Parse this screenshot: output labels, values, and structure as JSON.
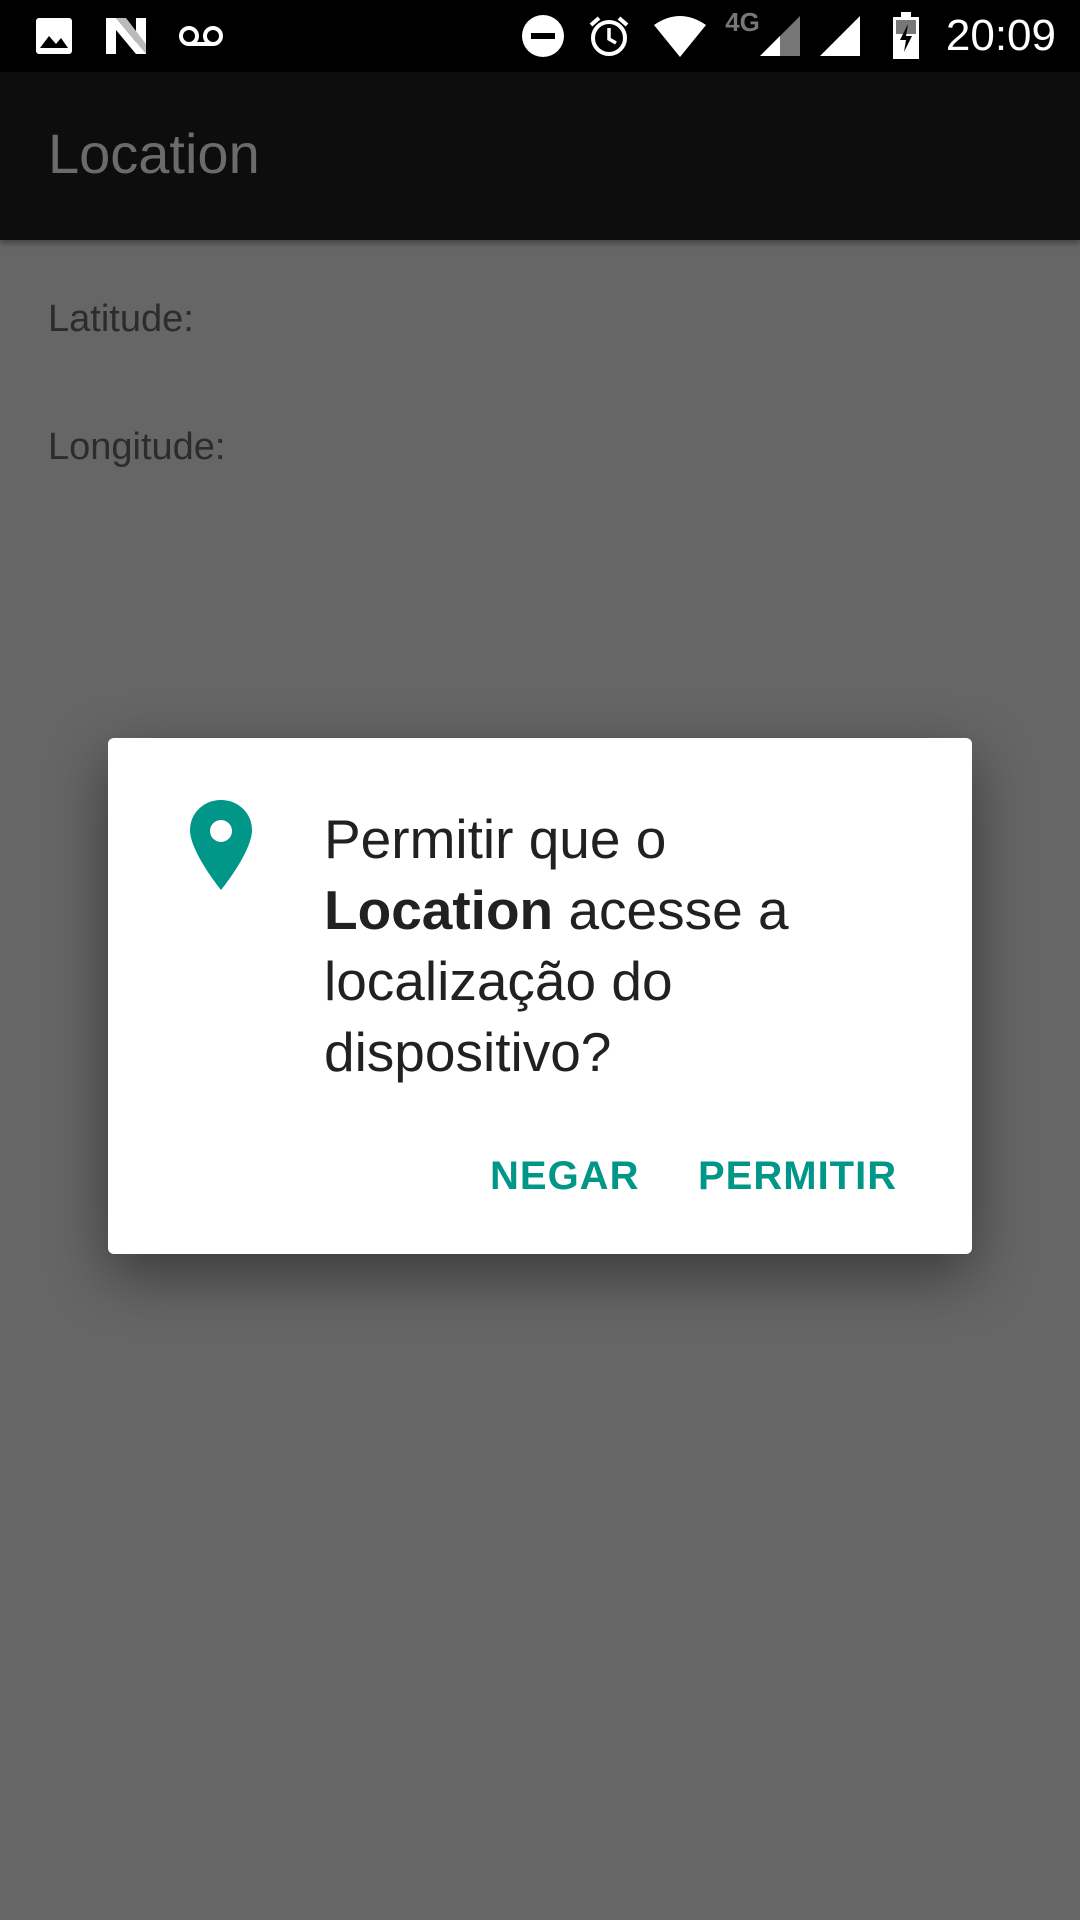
{
  "status_bar": {
    "left_icons": [
      "image-icon",
      "n-logo-icon",
      "voicemail-icon"
    ],
    "right_icons": [
      "do-not-disturb-icon",
      "alarm-icon",
      "wifi-icon",
      "mobile-signal-icon",
      "signal-icon",
      "battery-charging-icon"
    ],
    "network_type": "4G",
    "time": "20:09"
  },
  "app_bar": {
    "title": "Location"
  },
  "main": {
    "latitude_label": "Latitude:",
    "longitude_label": "Longitude:"
  },
  "dialog": {
    "icon": "location-pin-icon",
    "message_prefix": "Permitir que o",
    "app_name": "Location",
    "message_suffix": " acesse a localização do dispositivo?",
    "deny_label": "NEGAR",
    "allow_label": "PERMITIR"
  },
  "colors": {
    "accent": "#009688",
    "scrim": "#666666",
    "status_bar": "#000000",
    "app_bar": "#0d0d0d"
  }
}
